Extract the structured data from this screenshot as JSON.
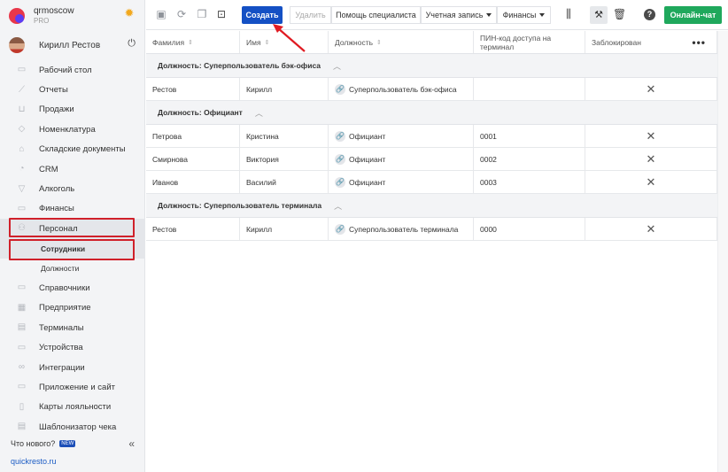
{
  "brand": {
    "name": "qrmoscow",
    "tier": "PRO"
  },
  "user": {
    "name": "Кирилл Рестов"
  },
  "nav": [
    {
      "label": "Рабочий стол",
      "icon": "monitor-icon"
    },
    {
      "label": "Отчеты",
      "icon": "chart-icon"
    },
    {
      "label": "Продажи",
      "icon": "basket-icon"
    },
    {
      "label": "Номенклатура",
      "icon": "tag-icon"
    },
    {
      "label": "Складские документы",
      "icon": "warehouse-icon"
    },
    {
      "label": "CRM",
      "icon": "crm-icon"
    },
    {
      "label": "Алкоголь",
      "icon": "glass-icon"
    },
    {
      "label": "Финансы",
      "icon": "wallet-icon"
    },
    {
      "label": "Персонал",
      "icon": "people-icon"
    }
  ],
  "nav_sub": [
    {
      "label": "Сотрудники"
    },
    {
      "label": "Должности"
    }
  ],
  "nav_rest": [
    {
      "label": "Справочники",
      "icon": "book-icon"
    },
    {
      "label": "Предприятие",
      "icon": "building-icon"
    },
    {
      "label": "Терминалы",
      "icon": "terminal-icon"
    },
    {
      "label": "Устройства",
      "icon": "device-icon"
    },
    {
      "label": "Интеграции",
      "icon": "infinity-icon"
    },
    {
      "label": "Приложение и сайт",
      "icon": "app-icon"
    },
    {
      "label": "Карты лояльности",
      "icon": "card-icon"
    },
    {
      "label": "Шаблонизатор чека",
      "icon": "receipt-icon"
    }
  ],
  "footer": {
    "whats_new": "Что нового?",
    "new_badge": "NEW",
    "site": "quickresto.ru"
  },
  "toolbar": {
    "create": "Создать",
    "delete": "Удалить",
    "help_specialist": "Помощь специалиста",
    "account": "Учетная запись",
    "finance": "Финансы",
    "chat": "Онлайн-чат",
    "help_glyph": "?"
  },
  "columns": [
    "Фамилия",
    "Имя",
    "Должность",
    "ПИН-код доступа на терминал",
    "Заблокирован"
  ],
  "groups": [
    {
      "title": "Должность: Суперпользователь бэк-офиса",
      "rows": [
        {
          "last": "Рестов",
          "first": "Кирилл",
          "position": "Суперпользователь бэк-офиса",
          "pin": ""
        }
      ]
    },
    {
      "title": "Должность: Официант",
      "rows": [
        {
          "last": "Петрова",
          "first": "Кристина",
          "position": "Официант",
          "pin": "0001"
        },
        {
          "last": "Смирнова",
          "first": "Виктория",
          "position": "Официант",
          "pin": "0002"
        },
        {
          "last": "Иванов",
          "first": "Василий",
          "position": "Официант",
          "pin": "0003"
        }
      ]
    },
    {
      "title": "Должность: Суперпользователь терминала",
      "rows": [
        {
          "last": "Рестов",
          "first": "Кирилл",
          "position": "Суперпользователь терминала",
          "pin": "0000"
        }
      ]
    }
  ],
  "colors": {
    "primary": "#1450c4",
    "chat": "#1fa85c",
    "highlight": "#d0202a",
    "sidebar": "#f3f4f6"
  }
}
